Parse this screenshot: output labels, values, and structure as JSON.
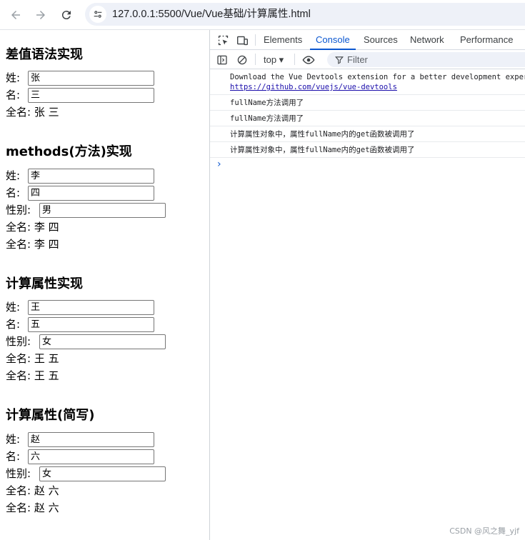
{
  "browser": {
    "url": "127.0.0.1:5500/Vue/Vue基础/计算属性.html"
  },
  "page": {
    "sections": [
      {
        "title": "差值语法实现",
        "rows": [
          {
            "label": "姓:",
            "value": "张"
          },
          {
            "label": "名:",
            "value": "三"
          }
        ],
        "outputs": [
          "全名: 张 三"
        ]
      },
      {
        "title": "methods(方法)实现",
        "rows": [
          {
            "label": "姓:",
            "value": "李"
          },
          {
            "label": "名:",
            "value": "四"
          },
          {
            "label": "性别:",
            "value": "男"
          }
        ],
        "outputs": [
          "全名: 李 四",
          "全名: 李 四"
        ]
      },
      {
        "title": "计算属性实现",
        "rows": [
          {
            "label": "姓:",
            "value": "王"
          },
          {
            "label": "名:",
            "value": "五"
          },
          {
            "label": "性别:",
            "value": "女"
          }
        ],
        "outputs": [
          "全名: 王 五",
          "全名: 王 五"
        ]
      },
      {
        "title": "计算属性(简写)",
        "rows": [
          {
            "label": "姓:",
            "value": "赵"
          },
          {
            "label": "名:",
            "value": "六"
          },
          {
            "label": "性别:",
            "value": "女"
          }
        ],
        "outputs": [
          "全名: 赵 六",
          "全名: 赵 六"
        ]
      }
    ]
  },
  "devtools": {
    "tabs": [
      "Elements",
      "Console",
      "Sources",
      "Network",
      "Performance"
    ],
    "active_tab": "Console",
    "context": "top ▾",
    "filter_placeholder": "Filter",
    "accent": "#0b57d0",
    "messages": [
      {
        "text": "Download the Vue Devtools extension for a better development experience:",
        "link": "https://github.com/vuejs/vue-devtools"
      },
      {
        "text": "fullName方法调用了"
      },
      {
        "text": "fullName方法调用了"
      },
      {
        "text": "计算属性对象中，属性fullName内的get函数被调用了"
      },
      {
        "text": "计算属性对象中，属性fullName内的get函数被调用了"
      }
    ],
    "prompt": "›"
  },
  "watermark": "CSDN @风之舞_yjf"
}
